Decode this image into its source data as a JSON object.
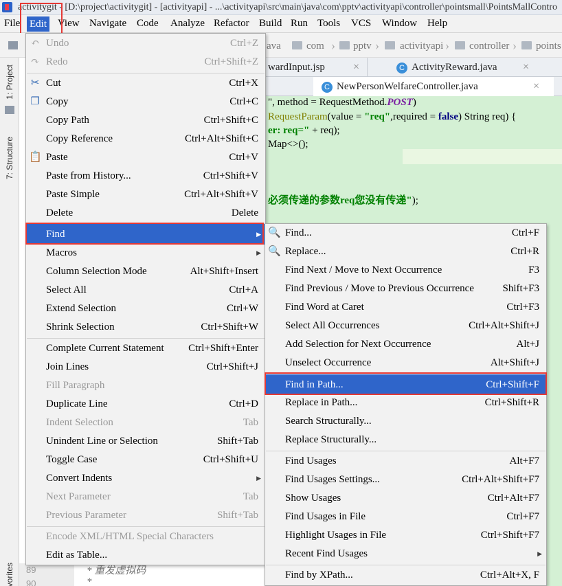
{
  "window": {
    "title": "activitygit - [D:\\project\\activitygit] - [activityapi] - ...\\activityapi\\src\\main\\java\\com\\pptv\\activityapi\\controller\\pointsmall\\PointsMallContro"
  },
  "menubar": [
    "File",
    "Edit",
    "View",
    "Navigate",
    "Code",
    "Analyze",
    "Refactor",
    "Build",
    "Run",
    "Tools",
    "VCS",
    "Window",
    "Help"
  ],
  "breadcrumb": [
    "ava",
    "com",
    "pptv",
    "activityapi",
    "controller",
    "points"
  ],
  "sidebar": {
    "project": "1: Project",
    "structure": "7: Structure",
    "favorites": "vorites"
  },
  "tabs": {
    "row1": [
      {
        "label": "wardInput.jsp"
      },
      {
        "label": "ActivityReward.java",
        "icon": "C"
      }
    ],
    "row2": [
      {
        "label": "NewPersonWelfareController.java",
        "icon": "C"
      }
    ]
  },
  "code": {
    "line1": {
      "a": "\", method = RequestMethod.",
      "b": "POST",
      "c": ")"
    },
    "line2": {
      "a": "RequestParam",
      "b": "(value = ",
      "c": "\"req\"",
      "d": ",required = ",
      "e": "false",
      "f": ") String req) {"
    },
    "line3": {
      "a": "er: req=\"",
      "b": " + req);"
    },
    "line4": {
      "a": "Map<>();"
    },
    "line5": {
      "a": "必须传递的参数req您没有传递\"",
      "b": ");"
    },
    "gutter_lines": [
      "89",
      "90"
    ],
    "comment1": "* 重发虚拟码",
    "comment2": "*"
  },
  "edit_menu": [
    {
      "label": "Undo",
      "shortcut": "Ctrl+Z",
      "disabled": true,
      "icon": "undo-icon"
    },
    {
      "label": "Redo",
      "shortcut": "Ctrl+Shift+Z",
      "disabled": true,
      "icon": "redo-icon"
    },
    {
      "label": "Cut",
      "shortcut": "Ctrl+X",
      "icon": "scissors-icon"
    },
    {
      "label": "Copy",
      "shortcut": "Ctrl+C",
      "icon": "copy-icon"
    },
    {
      "label": "Copy Path",
      "shortcut": "Ctrl+Shift+C"
    },
    {
      "label": "Copy Reference",
      "shortcut": "Ctrl+Alt+Shift+C"
    },
    {
      "label": "Paste",
      "shortcut": "Ctrl+V",
      "icon": "paste-icon"
    },
    {
      "label": "Paste from History...",
      "shortcut": "Ctrl+Shift+V"
    },
    {
      "label": "Paste Simple",
      "shortcut": "Ctrl+Alt+Shift+V"
    },
    {
      "label": "Delete",
      "shortcut": "Delete"
    },
    {
      "label": "Find",
      "submenu": true,
      "selected": true
    },
    {
      "label": "Macros",
      "submenu": true
    },
    {
      "label": "Column Selection Mode",
      "shortcut": "Alt+Shift+Insert"
    },
    {
      "label": "Select All",
      "shortcut": "Ctrl+A"
    },
    {
      "label": "Extend Selection",
      "shortcut": "Ctrl+W"
    },
    {
      "label": "Shrink Selection",
      "shortcut": "Ctrl+Shift+W"
    },
    {
      "label": "Complete Current Statement",
      "shortcut": "Ctrl+Shift+Enter"
    },
    {
      "label": "Join Lines",
      "shortcut": "Ctrl+Shift+J"
    },
    {
      "label": "Fill Paragraph",
      "disabled": true
    },
    {
      "label": "Duplicate Line",
      "shortcut": "Ctrl+D"
    },
    {
      "label": "Indent Selection",
      "shortcut": "Tab",
      "disabled": true
    },
    {
      "label": "Unindent Line or Selection",
      "shortcut": "Shift+Tab"
    },
    {
      "label": "Toggle Case",
      "shortcut": "Ctrl+Shift+U"
    },
    {
      "label": "Convert Indents",
      "submenu": true
    },
    {
      "label": "Next Parameter",
      "shortcut": "Tab",
      "disabled": true
    },
    {
      "label": "Previous Parameter",
      "shortcut": "Shift+Tab",
      "disabled": true
    },
    {
      "label": "Encode XML/HTML Special Characters",
      "disabled": true
    },
    {
      "label": "Edit as Table..."
    }
  ],
  "find_menu": [
    {
      "label": "Find...",
      "shortcut": "Ctrl+F",
      "icon": "search-icon"
    },
    {
      "label": "Replace...",
      "shortcut": "Ctrl+R",
      "icon": "replace-icon"
    },
    {
      "label": "Find Next / Move to Next Occurrence",
      "shortcut": "F3"
    },
    {
      "label": "Find Previous / Move to Previous Occurrence",
      "shortcut": "Shift+F3"
    },
    {
      "label": "Find Word at Caret",
      "shortcut": "Ctrl+F3"
    },
    {
      "label": "Select All Occurrences",
      "shortcut": "Ctrl+Alt+Shift+J"
    },
    {
      "label": "Add Selection for Next Occurrence",
      "shortcut": "Alt+J"
    },
    {
      "label": "Unselect Occurrence",
      "shortcut": "Alt+Shift+J"
    },
    {
      "label": "Find in Path...",
      "shortcut": "Ctrl+Shift+F",
      "selected": true
    },
    {
      "label": "Replace in Path...",
      "shortcut": "Ctrl+Shift+R"
    },
    {
      "label": "Search Structurally..."
    },
    {
      "label": "Replace Structurally..."
    },
    {
      "label": "Find Usages",
      "shortcut": "Alt+F7"
    },
    {
      "label": "Find Usages Settings...",
      "shortcut": "Ctrl+Alt+Shift+F7"
    },
    {
      "label": "Show Usages",
      "shortcut": "Ctrl+Alt+F7"
    },
    {
      "label": "Find Usages in File",
      "shortcut": "Ctrl+F7"
    },
    {
      "label": "Highlight Usages in File",
      "shortcut": "Ctrl+Shift+F7"
    },
    {
      "label": "Recent Find Usages",
      "submenu": true
    },
    {
      "label": "Find by XPath...",
      "shortcut": "Ctrl+Alt+X, F"
    }
  ],
  "colors": {
    "selection": "#2f65ca",
    "highlight_border": "#e53935",
    "editor_bg": "#d4f0d4"
  }
}
